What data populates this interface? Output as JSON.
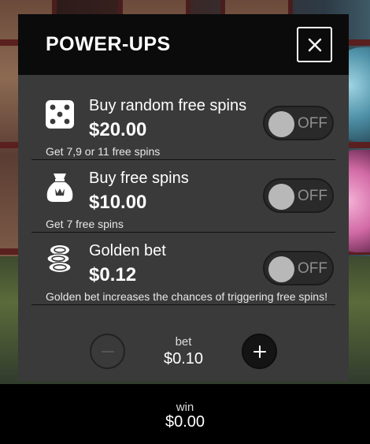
{
  "panel": {
    "title": "POWER-UPS"
  },
  "options": [
    {
      "name": "Buy random free spins",
      "price": "$20.00",
      "description": "Get 7,9 or 11 free spins",
      "toggle_state": "OFF",
      "icon": "dice-icon"
    },
    {
      "name": "Buy free spins",
      "price": "$10.00",
      "description": "Get 7 free spins",
      "toggle_state": "OFF",
      "icon": "money-bag-icon"
    },
    {
      "name": "Golden bet",
      "price": "$0.12",
      "description": "Golden bet increases the chances of triggering free spins!",
      "toggle_state": "OFF",
      "icon": "coin-stack-icon"
    }
  ],
  "bet": {
    "label": "bet",
    "value": "$0.10"
  },
  "win": {
    "label": "win",
    "value": "$0.00"
  },
  "colors": {
    "panel_bg": "#3a3a3a",
    "header_bg": "#0b0b0b",
    "toggle_knob": "#b8b8b8",
    "toggle_text": "#8f8f8f"
  }
}
